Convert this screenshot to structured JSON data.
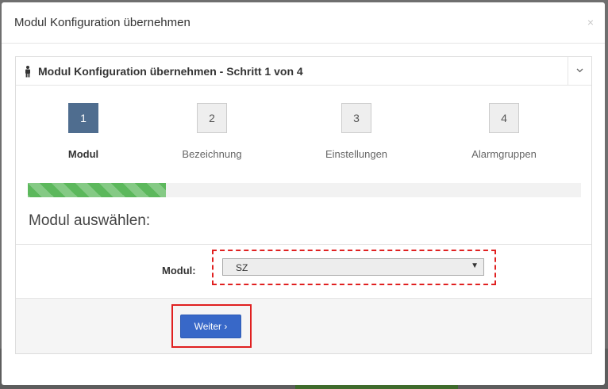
{
  "modal": {
    "title": "Modul Konfiguration übernehmen",
    "close": "×"
  },
  "panel": {
    "title": "Modul Konfiguration übernehmen - Schritt 1 von 4"
  },
  "steps": [
    {
      "number": "1",
      "label": "Modul",
      "active": true
    },
    {
      "number": "2",
      "label": "Bezeichnung",
      "active": false
    },
    {
      "number": "3",
      "label": "Einstellungen",
      "active": false
    },
    {
      "number": "4",
      "label": "Alarmgruppen",
      "active": false
    }
  ],
  "progress": {
    "percent": 25
  },
  "section": {
    "title": "Modul auswählen:"
  },
  "form": {
    "label": "Modul:",
    "selected": "SZ",
    "arrow": "▼"
  },
  "buttons": {
    "next": "Weiter ›"
  },
  "colors": {
    "active_step": "#4f6d8f",
    "progress": "#5cb85c",
    "primary_button": "#3868c8",
    "highlight": "#e02020"
  }
}
